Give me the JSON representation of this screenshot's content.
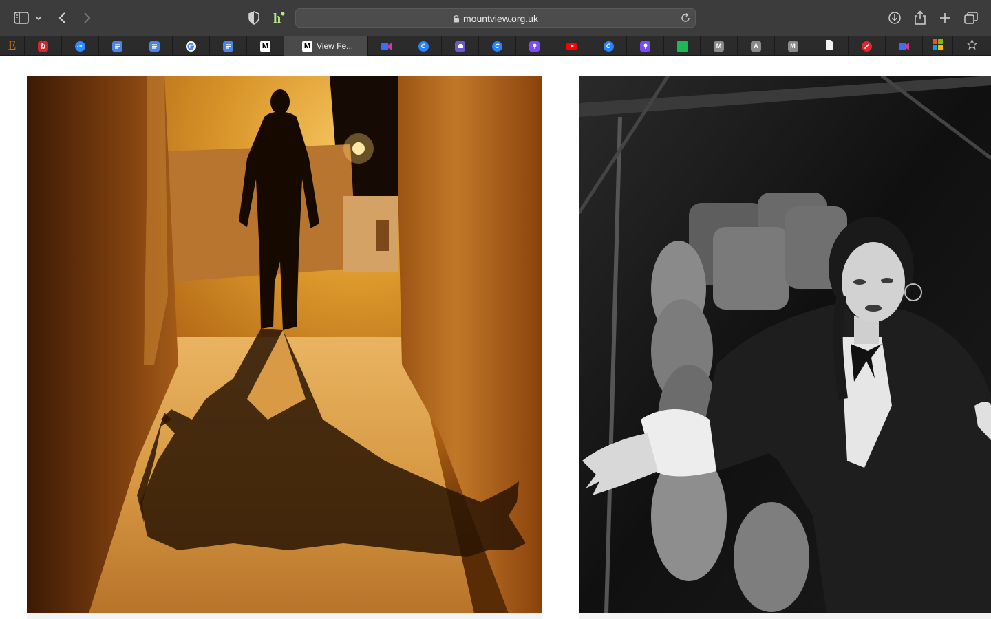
{
  "browser": {
    "url": "mountview.org.uk",
    "icons": [
      "sidebar-icon",
      "chevron-down-icon",
      "back-icon",
      "forward-icon",
      "privacy-shield-icon",
      "extension-icon",
      "lock-icon",
      "reload-icon",
      "download-icon",
      "share-icon",
      "new-tab-icon",
      "tab-overview-icon"
    ]
  },
  "favorites": [
    {
      "icon": "e-icon",
      "label": "",
      "color": "#e8730c"
    },
    {
      "icon": "bookmark-b-icon",
      "label": "",
      "color": "#d6262c"
    },
    {
      "icon": "zoom-icon",
      "label": "",
      "color": "#2d8cff"
    },
    {
      "icon": "docs-icon",
      "label": "",
      "color": "#4a86e8"
    },
    {
      "icon": "docs-icon",
      "label": "",
      "color": "#4a86e8"
    },
    {
      "icon": "google-icon",
      "label": "",
      "color": "#ffffff"
    },
    {
      "icon": "docs-icon",
      "label": "",
      "color": "#4a86e8"
    },
    {
      "icon": "m-icon",
      "label": "",
      "color": "#ffffff"
    },
    {
      "icon": "m-icon",
      "label": "View Fe...",
      "color": "#ffffff"
    },
    {
      "icon": "video-icon",
      "label": "",
      "color": "#3f6bf5"
    },
    {
      "icon": "c-icon",
      "label": "",
      "color": "#2684ff"
    },
    {
      "icon": "print-icon",
      "label": "",
      "color": "#6a5acd"
    },
    {
      "icon": "c-icon",
      "label": "",
      "color": "#2684ff"
    },
    {
      "icon": "pen-icon",
      "label": "",
      "color": "#7b4bf5"
    },
    {
      "icon": "youtube-icon",
      "label": "",
      "color": "#ff0000"
    },
    {
      "icon": "c-icon",
      "label": "",
      "color": "#2684ff"
    },
    {
      "icon": "pen-icon",
      "label": "",
      "color": "#7b4bf5"
    },
    {
      "icon": "square-icon",
      "label": "",
      "color": "#1db954"
    },
    {
      "icon": "m-gray-icon",
      "label": "",
      "color": "#8a8a8a"
    },
    {
      "icon": "a-gray-icon",
      "label": "",
      "color": "#8a8a8a"
    },
    {
      "icon": "m-gray-icon",
      "label": "",
      "color": "#8a8a8a"
    },
    {
      "icon": "file-icon",
      "label": "",
      "color": "#f2f2f2"
    },
    {
      "icon": "no-icon",
      "label": "",
      "color": "#e8242b"
    },
    {
      "icon": "video-icon",
      "label": "",
      "color": "#3f6bf5"
    },
    {
      "icon": "microsoft-icon",
      "label": "",
      "color": "#f25022"
    },
    {
      "icon": "star-icon",
      "label": "",
      "color": "#bdbdbd"
    }
  ],
  "favorite_glyphs": {
    "e": "E",
    "b": "b",
    "zm": "zm",
    "m": "M",
    "a": "A",
    "c": "C"
  },
  "page": {
    "images": [
      {
        "name": "shadow-cat-photo",
        "description_hidden": true
      },
      {
        "name": "portrait-photo",
        "description_hidden": true
      }
    ]
  }
}
